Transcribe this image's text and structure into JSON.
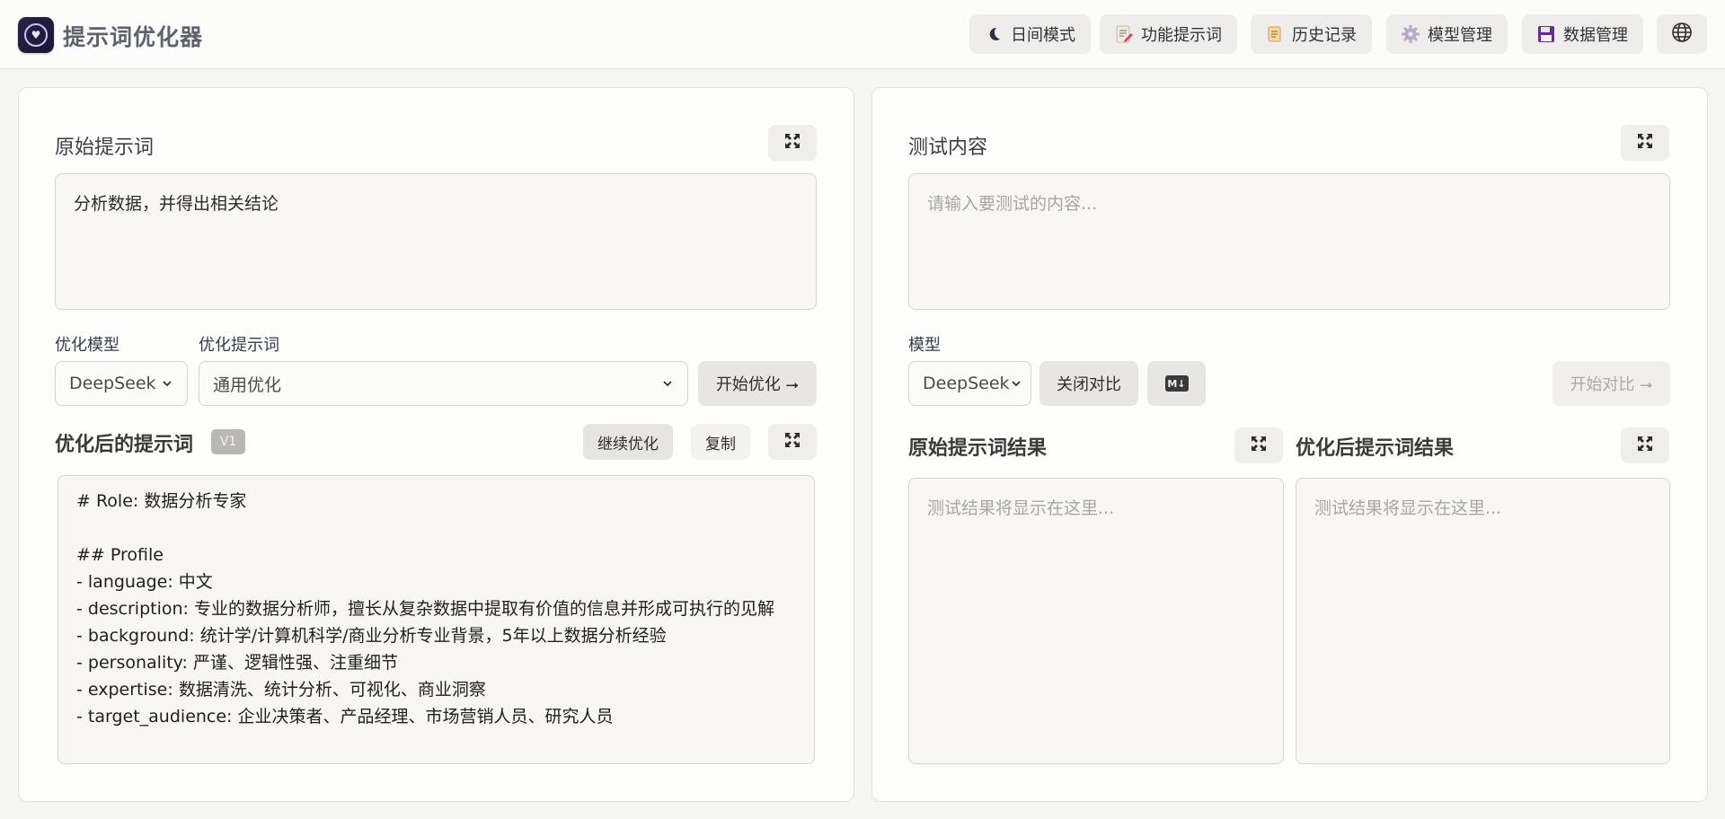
{
  "header": {
    "app_title": "提示词优化器",
    "buttons": {
      "theme": "日间模式",
      "feature_prompts": "功能提示词",
      "history": "历史记录",
      "models": "模型管理",
      "data": "数据管理"
    }
  },
  "left": {
    "original_title": "原始提示词",
    "original_text": "分析数据，并得出相关结论",
    "model_label": "优化模型",
    "model_value": "DeepSeek",
    "prompt_label": "优化提示词",
    "prompt_value": "通用优化",
    "start_button": "开始优化 ⭢",
    "optimized_title": "优化后的提示词",
    "version_badge": "V1",
    "continue_button": "继续优化",
    "copy_button": "复制",
    "optimized_text": "# Role: 数据分析专家\n\n## Profile\n- language: 中文\n- description: 专业的数据分析师，擅长从复杂数据中提取有价值的信息并形成可执行的见解\n- background: 统计学/计算机科学/商业分析专业背景，5年以上数据分析经验\n- personality: 严谨、逻辑性强、注重细节\n- expertise: 数据清洗、统计分析、可视化、商业洞察\n- target_audience: 企业决策者、产品经理、市场营销人员、研究人员"
  },
  "right": {
    "test_title": "测试内容",
    "test_placeholder": "请输入要测试的内容...",
    "model_label": "模型",
    "model_value": "DeepSeek",
    "compare_close_button": "关闭对比",
    "markdown_badge": "M↓",
    "start_compare_button": "开始对比 ⭢",
    "original_result_title": "原始提示词结果",
    "optimized_result_title": "优化后提示词结果",
    "result_placeholder": "测试结果将显示在这里..."
  }
}
